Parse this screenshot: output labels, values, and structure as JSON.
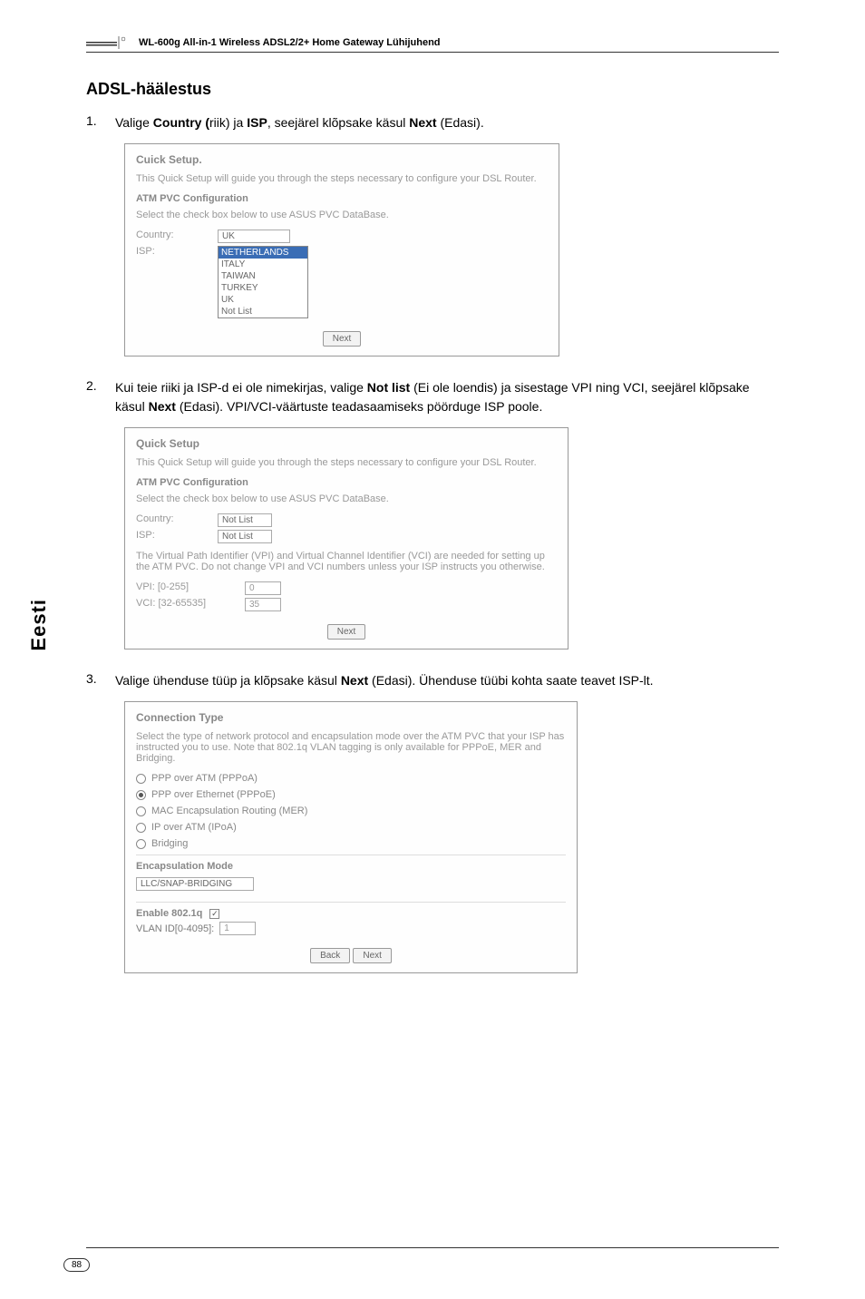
{
  "header": {
    "product": "WL-600g All-in-1 Wireless ADSL2/2+ Home Gateway Lühijuhend"
  },
  "sideTab": "Eesti",
  "pageNumber": "88",
  "title": "ADSL-häälestus",
  "steps": {
    "s1": {
      "num": "1.",
      "pre": "Valige ",
      "b1": "Country (",
      "mid1": "riik) ja ",
      "b2": "ISP",
      "mid2": ", seejärel klõpsake käsul ",
      "b3": "Next",
      "post": " (Edasi)."
    },
    "s2": {
      "num": "2.",
      "pre": "Kui teie riiki ja ISP-d ei ole nimekirjas, valige ",
      "b1": "Not list",
      "mid1": " (Ei ole loendis) ja sisestage VPI ning VCI, seejärel klõpsake käsul ",
      "b2": "Next",
      "post": " (Edasi). VPI/VCI-väärtuste teadasaamiseks pöörduge ISP poole."
    },
    "s3": {
      "num": "3.",
      "pre": "Valige ühenduse tüüp ja klõpsake käsul ",
      "b1": "Next",
      "post": " (Edasi). Ühenduse tüübi kohta saate teavet ISP-lt."
    }
  },
  "shot1": {
    "title": "Cuick Setup.",
    "desc": "This Quick Setup will guide you through the steps necessary to configure your DSL Router.",
    "sub": "ATM PVC Configuration",
    "note": "Select the check box below to use ASUS PVC DataBase.",
    "countryLabel": "Country:",
    "ispLabel": "ISP:",
    "selected": "UK",
    "options": [
      "NETHERLANDS",
      "ITALY",
      "TAIWAN",
      "TURKEY",
      "UK",
      "Not List"
    ],
    "next": "Next"
  },
  "shot2": {
    "title": "Quick Setup",
    "desc": "This Quick Setup will guide you through the steps necessary to configure your DSL Router.",
    "sub": "ATM PVC Configuration",
    "note": "Select the check box below to use ASUS PVC DataBase.",
    "countryLabel": "Country:",
    "ispLabel": "ISP:",
    "countryVal": "Not List",
    "ispVal": "Not List",
    "vtext": "The Virtual Path Identifier (VPI) and Virtual Channel Identifier (VCI) are needed for setting up the ATM PVC. Do not change VPI and VCI numbers unless your ISP instructs you otherwise.",
    "vpiLabel": "VPI: [0-255]",
    "vpiVal": "0",
    "vciLabel": "VCI: [32-65535]",
    "vciVal": "35",
    "next": "Next"
  },
  "shot3": {
    "title": "Connection Type",
    "desc": "Select the type of network protocol and encapsulation mode over the ATM PVC that your ISP has instructed you to use. Note that 802.1q VLAN tagging is only available for PPPoE, MER and Bridging.",
    "r1": "PPP over ATM (PPPoA)",
    "r2": "PPP over Ethernet (PPPoE)",
    "r3": "MAC Encapsulation Routing (MER)",
    "r4": "IP over ATM (IPoA)",
    "r5": "Bridging",
    "encTitle": "Encapsulation Mode",
    "encVal": "LLC/SNAP-BRIDGING",
    "enableLabel": "Enable 802.1q",
    "vlanLabel": "VLAN ID[0-4095]:",
    "vlanVal": "1",
    "back": "Back",
    "next": "Next"
  }
}
